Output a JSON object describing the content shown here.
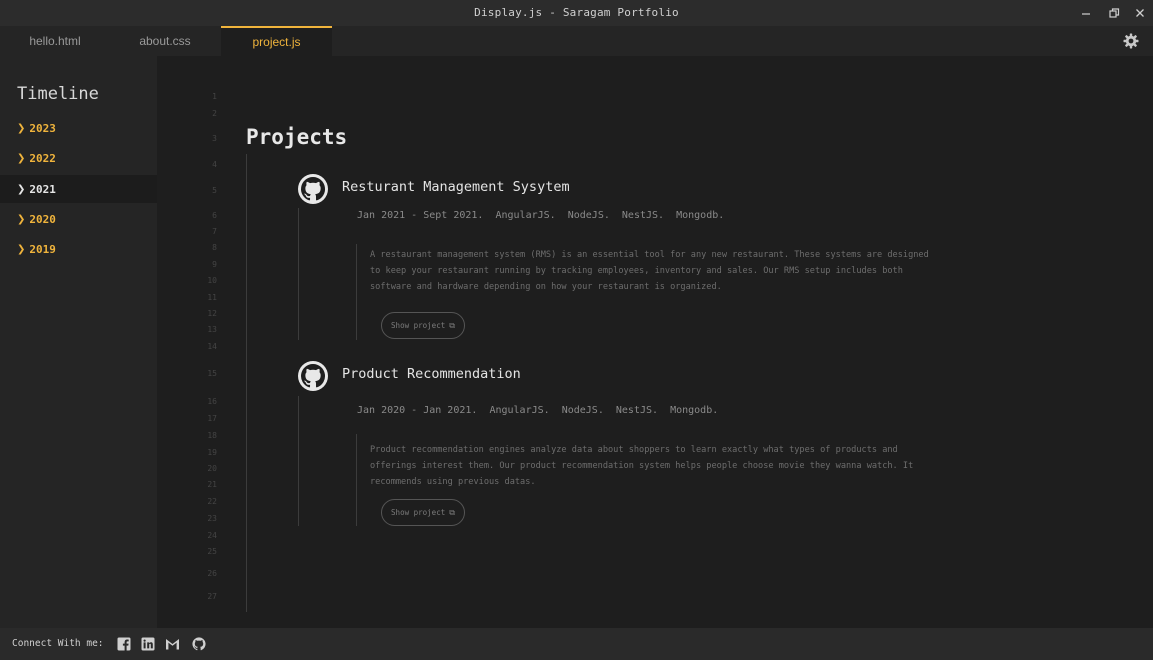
{
  "window": {
    "title": "Display.js - Saragam Portfolio"
  },
  "tabs": [
    {
      "label": "hello.html",
      "active": false
    },
    {
      "label": "about.css",
      "active": false
    },
    {
      "label": "project.js",
      "active": true
    }
  ],
  "sidebar": {
    "heading": "Timeline",
    "years": [
      {
        "label": "2023",
        "active": false
      },
      {
        "label": "2022",
        "active": false
      },
      {
        "label": "2021",
        "active": true
      },
      {
        "label": "2020",
        "active": false
      },
      {
        "label": "2019",
        "active": false
      }
    ]
  },
  "editor": {
    "line_numbers": [
      "1",
      "2",
      "3",
      "4",
      "5",
      "6",
      "7",
      "8",
      "9",
      "10",
      "11",
      "12",
      "13",
      "14",
      "15",
      "16",
      "17",
      "18",
      "19",
      "20",
      "21",
      "22",
      "23",
      "24",
      "25",
      "26",
      "27"
    ],
    "heading": "Projects",
    "projects": [
      {
        "title": "Resturant Management Sysytem",
        "meta": "Jan 2021 - Sept 2021.  AngularJS.  NodeJS.  NestJS.  Mongodb.",
        "description": "A restaurant management system (RMS) is an essential tool for any new restaurant. These systems are designed to keep your restaurant running by tracking employees, inventory and sales. Our RMS setup includes both software and hardware depending on how your restaurant is organized.",
        "button_label": "Show project"
      },
      {
        "title": "Product Recommendation",
        "meta": "Jan 2020 - Jan 2021.  AngularJS.  NodeJS.  NestJS.  Mongodb.",
        "description": "Product recommendation engines analyze data about shoppers to learn exactly what types of products and offerings interest them. Our product recommendation system helps people choose movie they wanna watch. It recommends using previous datas.",
        "button_label": "Show project"
      }
    ]
  },
  "statusbar": {
    "label": "Connect With me:",
    "icons": [
      "facebook-icon",
      "linkedin-icon",
      "gmail-icon",
      "github-icon"
    ]
  },
  "colors": {
    "accent": "#f0b43c",
    "background": "#1e1e1e",
    "sidebar": "#252525"
  }
}
